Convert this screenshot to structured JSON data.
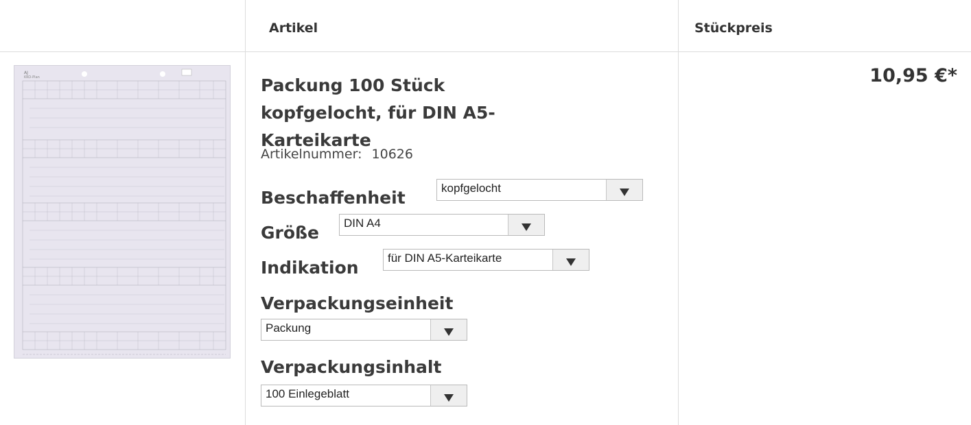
{
  "header": {
    "col_article": "Artikel",
    "col_price": "Stückpreis"
  },
  "product": {
    "title": "Packung 100 Stück kopfgelocht, für DIN A5-Karteikarte",
    "article_number_label": "Artikelnummer:",
    "article_number": "10626",
    "price": "10,95 €*",
    "options": [
      {
        "label": "Beschaffenheit",
        "value": "kopfgelocht"
      },
      {
        "label": "Größe",
        "value": "DIN A4"
      },
      {
        "label": "Indikation",
        "value": "für DIN A5-Karteikarte"
      },
      {
        "label": "Verpackungseinheit",
        "value": "Packung"
      },
      {
        "label": "Verpackungsinhalt",
        "value": "100 Einlegeblatt"
      }
    ]
  },
  "colors": {
    "border": "#dcdcdc",
    "text": "#333333",
    "thumbnail_paper": "#e9e6f0"
  },
  "icons": [
    "dropdown-arrow-icon"
  ]
}
